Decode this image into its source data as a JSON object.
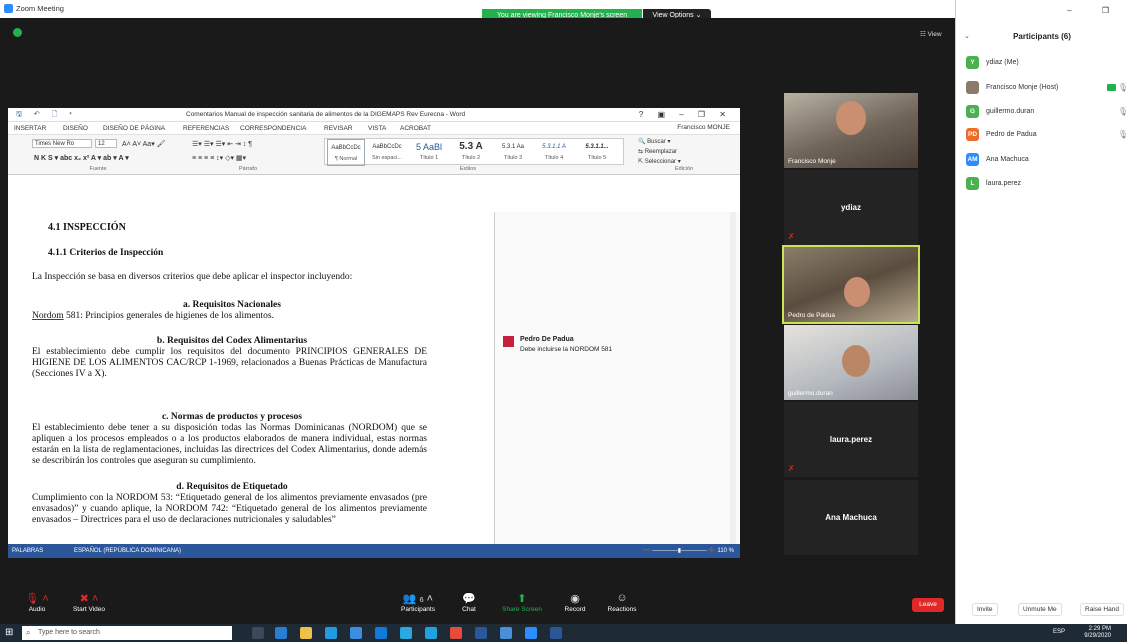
{
  "window": {
    "title": "Zoom Meeting",
    "banner": "You are viewing Francisco Monje's screen",
    "view_options": "View Options ⌄",
    "gallery_view": "☷ View"
  },
  "word": {
    "doc_title": "Comentarios Manual de inspección sanitaria de alimentos de la DIGEMAPS Rev Eurecna - Word",
    "tabs": [
      "INSERTAR",
      "DISEÑO",
      "DISEÑO DE PÁGINA",
      "REFERENCIAS",
      "CORRESPONDENCIA",
      "REVISAR",
      "VISTA",
      "ACROBAT"
    ],
    "user": "Francisco MONJE",
    "font_name": "Times New Ro",
    "font_size": "12",
    "group_labels": {
      "fuente": "Fuente",
      "parrafo": "Párrafo",
      "estilos": "Estilos",
      "edicion": "Edición"
    },
    "styles": [
      {
        "sample": "AaBbCcDc",
        "name": "¶ Normal"
      },
      {
        "sample": "AaBbCcDc",
        "name": "Sin espaci..."
      },
      {
        "sample": "5 AaBl",
        "name": "Título 1"
      },
      {
        "sample": "5.3 A",
        "name": "Título 2"
      },
      {
        "sample": "5.3.1 Aa",
        "name": "Título 3"
      },
      {
        "sample": "5.3.1.1 A",
        "name": "Título 4"
      },
      {
        "sample": "5.3.1.1...",
        "name": "Título 5"
      }
    ],
    "edit": {
      "find": "Buscar",
      "replace": "Reemplazar",
      "select": "Seleccionar"
    },
    "body": {
      "h1": "4.1 INSPECCIÓN",
      "h2": "4.1.1   Criterios de Inspección",
      "intro": "La Inspección se basa en diversos criterios que debe aplicar el inspector incluyendo:",
      "a_title": "a.   Requisitos Nacionales",
      "a_text_link": "Nordom",
      "a_text": " 581: Principios generales de higienes de los alimentos.",
      "b_title": "b.   Requisitos del Codex Alimentarius",
      "b_text": "El establecimiento debe  cumplir los requisitos del documento PRINCIPIOS GENERALES DE HIGIENE DE LOS ALIMENTOS CAC/RCP 1-1969, relacionados a Buenas Prácticas de Manufactura (Secciones IV a X).",
      "c_title": "c.   Normas de productos y procesos",
      "c_text": "El establecimiento debe tener a su disposición todas las Normas Dominicanas (NORDOM) que se apliquen a los procesos empleados o a los productos elaborados de manera individual, estas normas estarán en la lista de reglamentaciones, incluidas las directrices del Codex Alimentarius, donde además se describirán los controles que aseguran su cumplimiento.",
      "d_title": "d.   Requisitos de Etiquetado",
      "d_text": "Cumplimiento con la NORDOM 53: “Etiquetado general de los alimentos previamente envasados (pre envasados)” y cuando aplique, la NORDOM 742: “Etiquetado general de los alimentos previamente envasados – Directrices para el uso de declaraciones nutricionales y saludables”"
    },
    "comment": {
      "author": "Pedro De Padua",
      "text": "Debe incluirse la NORDOM 581"
    },
    "status": {
      "words": "PALABRAS",
      "lang": "ESPAÑOL (REPÚBLICA DOMINICANA)",
      "zoom": "110 %"
    }
  },
  "tiles": [
    {
      "name": "Francisco Monje",
      "video": true
    },
    {
      "name": "ydiaz",
      "video": false
    },
    {
      "name": "Pedro de Padua",
      "video": true,
      "active": true
    },
    {
      "name": "guillermo.duran",
      "video": true
    },
    {
      "name": "laura.perez",
      "video": false
    },
    {
      "name": "Ana Machuca",
      "video": false
    }
  ],
  "toolbar": {
    "audio": "Audio",
    "start_video": "Start Video",
    "participants": "Participants",
    "participants_count": "6",
    "chat": "Chat",
    "share": "Share Screen",
    "record": "Record",
    "reactions": "Reactions",
    "leave": "Leave"
  },
  "panel": {
    "title": "Participants (6)",
    "participants": [
      {
        "initial": "Y",
        "name": "ydiaz (Me)",
        "color": "#4caf50"
      },
      {
        "initial": "",
        "name": "Francisco Monje (Host)",
        "color": "#8a7a6a"
      },
      {
        "initial": "G",
        "name": "guillermo.duran",
        "color": "#4caf50"
      },
      {
        "initial": "PD",
        "name": "Pedro de Padua",
        "color": "#f06a2a"
      },
      {
        "initial": "AM",
        "name": "Ana Machuca",
        "color": "#2d8cff"
      },
      {
        "initial": "L",
        "name": "laura.perez",
        "color": "#4caf50"
      }
    ],
    "invite": "Invite",
    "unmute_me": "Unmute Me",
    "raise_hand": "Raise Hand"
  },
  "taskbar": {
    "search_placeholder": "Type here to search",
    "lang": "ESP",
    "time": "2:29 PM",
    "date": "9/29/2020"
  },
  "colors": {
    "word_blue": "#2b579a",
    "zoom_green": "#23b14d",
    "leave_red": "#e02828",
    "active_border": "#c9e455"
  }
}
